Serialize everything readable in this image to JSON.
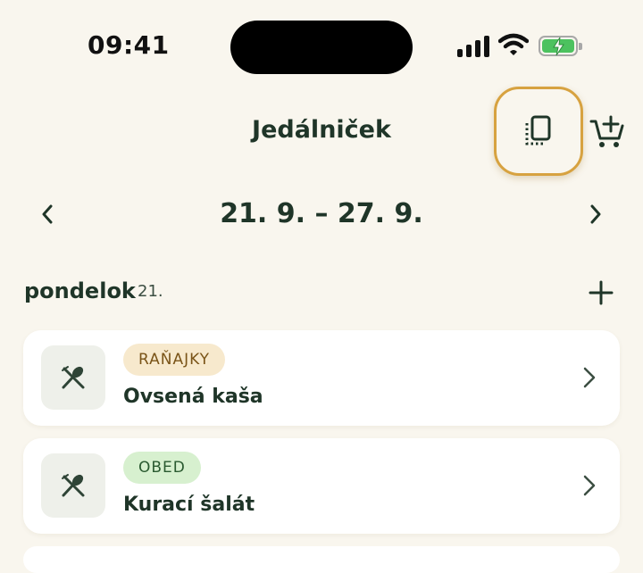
{
  "status": {
    "time": "09:41"
  },
  "header": {
    "title": "Jedálniček",
    "copy_icon": "copy-pages-icon",
    "cart_icon": "add-to-cart-icon"
  },
  "week": {
    "label": "21. 9. – 27. 9.",
    "prev_icon": "chevron-left-icon",
    "next_icon": "chevron-right-icon"
  },
  "day": {
    "name": "pondelok",
    "date": "21.",
    "add_icon": "plus-icon"
  },
  "meals": [
    {
      "tag": "RAŇAJKY",
      "name": "Ovsená kaša",
      "icon": "fork-spoon-icon",
      "tag_color": "#f7e9cd"
    },
    {
      "tag": "OBED",
      "name": "Kurací šalát",
      "icon": "fork-spoon-icon",
      "tag_color": "#d7f0cf"
    }
  ],
  "colors": {
    "background": "#f9f6ee",
    "primary": "#1f3528",
    "highlight": "#d7a240"
  }
}
